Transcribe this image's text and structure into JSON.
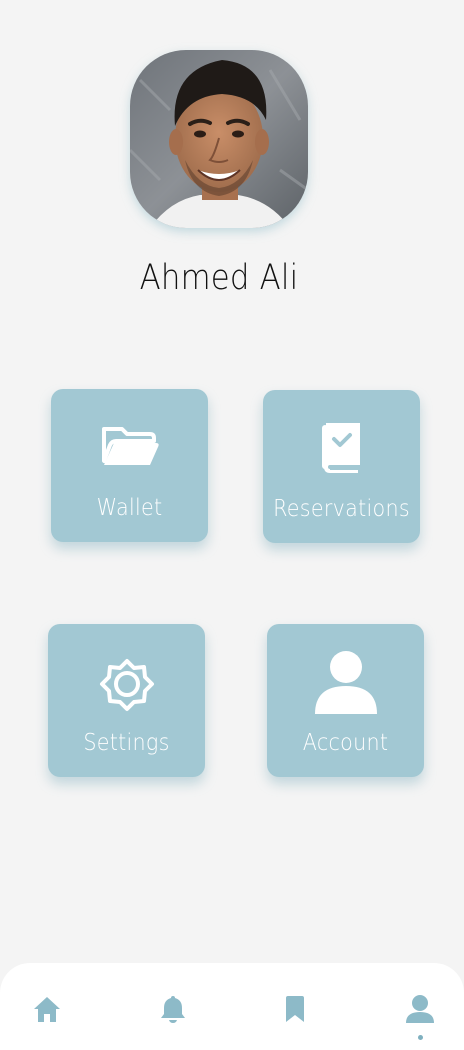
{
  "profile": {
    "name": "Ahmed Ali",
    "avatar_icon": "profile-photo"
  },
  "menu": [
    {
      "label": "Wallet",
      "icon": "folder-icon"
    },
    {
      "label": "Reservations",
      "icon": "book-check-icon"
    },
    {
      "label": "Settings",
      "icon": "gear-icon"
    },
    {
      "label": "Account",
      "icon": "person-icon"
    }
  ],
  "bottom_nav": {
    "items": [
      {
        "icon": "home-icon"
      },
      {
        "icon": "bell-icon"
      },
      {
        "icon": "bookmark-icon"
      },
      {
        "icon": "profile-icon",
        "active": true
      }
    ]
  },
  "colors": {
    "background": "#f4f4f4",
    "tile": "#a2c8d3",
    "nav_icon": "#8dbac8",
    "text_dark": "#111111",
    "text_light": "#ffffff"
  }
}
